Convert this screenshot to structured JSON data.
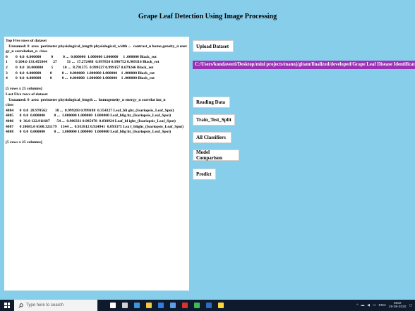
{
  "window": {
    "title": "Grape Leaf Detection Using Image Processing"
  },
  "output_text": "Top Five rows of dataset\n   Unnamed: 0  area  perimeter physiological_length physiological_width ...  contrast_n homo geneity_n energy_n correlation_n  class\n0        0  0.0  0.000000          0          0 ...  0.000000  1.000000 1.000000     1 .000000 Black_rot\n1        0 204.0 133.455844      27          51 ...  17.272488  0.997850 0.996752 0.969116 Black_rot\n2        0  0.0  10.000000        5          10 ...  8.791575  0.999227 0.999157 0.679246 Black_rot\n3        0  0.0  0.000000         0          0 ...  0.000000  1.000000 1.000000    1 .000000 Black_rot\n4        0  0.0  0.000000         0          0 ...  0.000000  1.000000 1.000000    1 .000000 Black_rot\n\n[5 rows x 25 columns]\nLast Five rows of dataset\n   Unnamed: 0  area  perimeter physiological_length ...  homogeneity_n energy_n correlat ion_n                      class\n4084      0  0.0  28.970562        18 ...  0.999203 0.999188  0.354327 Leaf_bli ght_(Isariopsis_Leaf_Spot)\n4085      0  0.0  0.000000         0 ...  1.000000 1.000000  1.000000 Leaf_blig ht_(Isariopsis_Leaf_Spot)\n4086      0  36.0 122.911687       54 ...  0.986331 0.985478  0.838924 Leaf_bl ight_(Isariopsis_Leaf_Spot)\n4087      0 20685.0 6500.321179    1344 ...  0.933812 0.924941  0.893375 Lea f_blight_(Isariopsis_Leaf_Spot)\n4088      0  0.0  0.000000         0 ...  1.000000 1.000000  1.000000 Leaf_blig ht_(Isariopsis_Leaf_Spot)\n\n[5 rows x 25 columns]",
  "buttons": {
    "upload": "Upload Dataset",
    "reading": "Reading Data",
    "split": "Train_Test_Split",
    "classifiers": "All Classifiers",
    "comparison": "Model Comparison",
    "predict": "Predict"
  },
  "dataset_path": "C:/Users/kondaveeti/Desktop/mini projects/manoj/gitam/finalized/developed/Grape Leaf Disease Identification",
  "colors": {
    "background": "#87ceeb",
    "path_bar": "#9b30b2",
    "taskbar": "#0f1b2c"
  },
  "taskbar": {
    "search_placeholder": "Type here to search",
    "app_icons": [
      {
        "name": "cortana-icon",
        "color": "#ffffff"
      },
      {
        "name": "task-view-icon",
        "color": "#d0d0d0"
      },
      {
        "name": "edge-icon",
        "color": "#3a96dd"
      },
      {
        "name": "file-explorer-icon",
        "color": "#f4c542"
      },
      {
        "name": "store-icon",
        "color": "#2f7de1"
      },
      {
        "name": "mail-icon",
        "color": "#5aa0e6"
      },
      {
        "name": "app-red-icon",
        "color": "#d9332a"
      },
      {
        "name": "chrome-icon",
        "color": "#3cba54"
      },
      {
        "name": "app-blue-icon",
        "color": "#2b6cc4"
      },
      {
        "name": "python-icon",
        "color": "#ffd43b"
      }
    ],
    "lang": "ENG",
    "time": "0832",
    "date": "26-09-2020"
  }
}
